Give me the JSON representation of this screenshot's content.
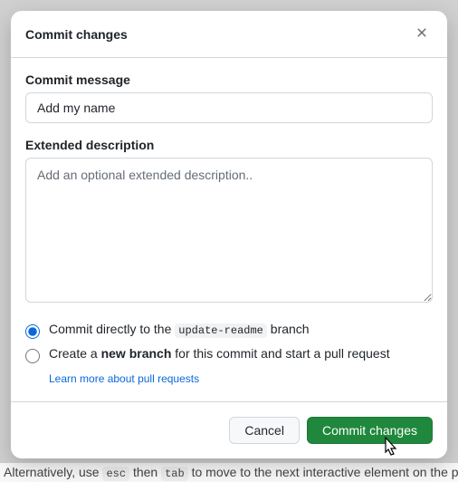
{
  "modal": {
    "title": "Commit changes",
    "commit_message": {
      "label": "Commit message",
      "value": "Add my name"
    },
    "extended_description": {
      "label": "Extended description",
      "placeholder": "Add an optional extended description.."
    },
    "radio": {
      "direct_prefix": "Commit directly to the ",
      "direct_branch": "update-readme",
      "direct_suffix": " branch",
      "new_branch_prefix": "Create a ",
      "new_branch_bold": "new branch",
      "new_branch_suffix": " for this commit and start a pull request",
      "learn_more": "Learn more about pull requests"
    },
    "footer": {
      "cancel": "Cancel",
      "commit": "Commit changes"
    }
  },
  "backdrop": {
    "text_prefix": "Alternatively, use ",
    "key1": "esc",
    "text_mid": " then ",
    "key2": "tab",
    "text_suffix": " to move to the next interactive element on the pa"
  }
}
